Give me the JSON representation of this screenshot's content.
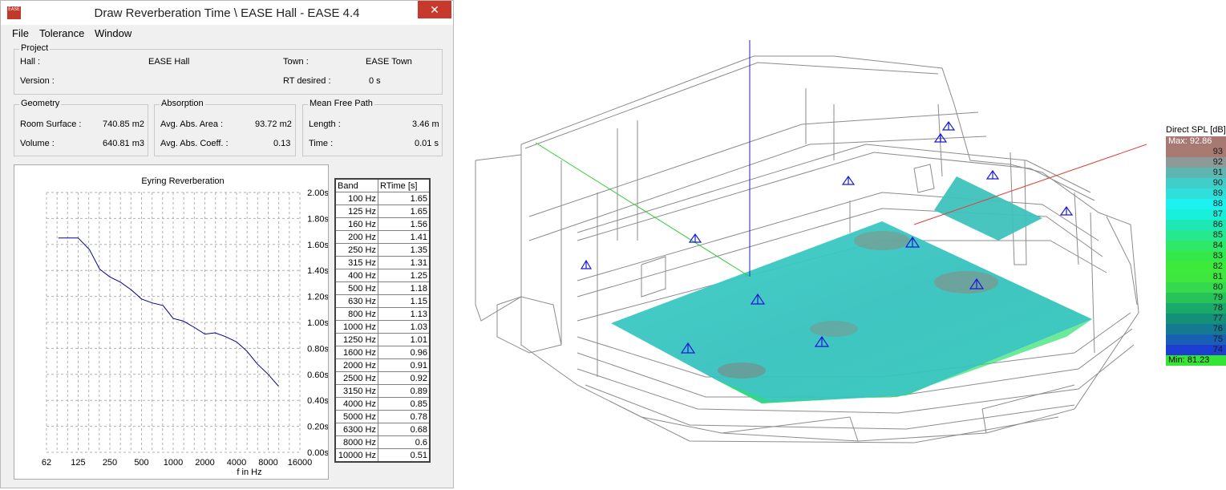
{
  "window": {
    "title": "Draw Reverberation Time \\ EASE Hall - EASE 4.4",
    "close_glyph": "✕",
    "icon_text": "EASE"
  },
  "menu": [
    "File",
    "Tolerance",
    "Window"
  ],
  "project": {
    "group_title": "Project",
    "hall_label": "Hall :",
    "hall_value": "EASE Hall",
    "town_label": "Town :",
    "town_value": "EASE Town",
    "version_label": "Version :",
    "rt_label": "RT desired :",
    "rt_value": "0 s"
  },
  "geometry": {
    "group_title": "Geometry",
    "surface_label": "Room Surface :",
    "surface_value": "740.85 m2",
    "volume_label": "Volume :",
    "volume_value": "640.81 m3"
  },
  "absorption": {
    "group_title": "Absorption",
    "area_label": "Avg. Abs. Area :",
    "area_value": "93.72 m2",
    "coeff_label": "Avg. Abs. Coeff. :",
    "coeff_value": "0.13"
  },
  "mfp": {
    "group_title": "Mean Free Path",
    "length_label": "Length :",
    "length_value": "3.46 m",
    "time_label": "Time :",
    "time_value": "0.01 s"
  },
  "chart_data": {
    "type": "line",
    "title": "Eyring Reverberation",
    "xlabel": "f in Hz",
    "ylabel": "",
    "xscale": "log",
    "xticks": [
      "62",
      "125",
      "250",
      "500",
      "1000",
      "2000",
      "4000",
      "8000",
      "16000"
    ],
    "yticks": [
      "0.00s",
      "0.20s",
      "0.40s",
      "0.60s",
      "0.80s",
      "1.00s",
      "1.20s",
      "1.40s",
      "1.60s",
      "1.80s",
      "2.00s"
    ],
    "ylim": [
      0,
      2.0
    ],
    "grid": true,
    "line_color": "#00008b",
    "x": [
      100,
      125,
      160,
      200,
      250,
      315,
      400,
      500,
      630,
      800,
      1000,
      1250,
      1600,
      2000,
      2500,
      3150,
      4000,
      5000,
      6300,
      8000,
      10000
    ],
    "values": [
      1.65,
      1.65,
      1.56,
      1.41,
      1.35,
      1.31,
      1.25,
      1.18,
      1.15,
      1.13,
      1.03,
      1.01,
      0.96,
      0.91,
      0.92,
      0.89,
      0.85,
      0.78,
      0.68,
      0.6,
      0.51
    ]
  },
  "table": {
    "headers": [
      "Band",
      "RTime [s]"
    ],
    "rows": [
      [
        "100 Hz",
        "1.65"
      ],
      [
        "125 Hz",
        "1.65"
      ],
      [
        "160 Hz",
        "1.56"
      ],
      [
        "200 Hz",
        "1.41"
      ],
      [
        "250 Hz",
        "1.35"
      ],
      [
        "315 Hz",
        "1.31"
      ],
      [
        "400 Hz",
        "1.25"
      ],
      [
        "500 Hz",
        "1.18"
      ],
      [
        "630 Hz",
        "1.15"
      ],
      [
        "800 Hz",
        "1.13"
      ],
      [
        "1000 Hz",
        "1.03"
      ],
      [
        "1250 Hz",
        "1.01"
      ],
      [
        "1600 Hz",
        "0.96"
      ],
      [
        "2000 Hz",
        "0.91"
      ],
      [
        "2500 Hz",
        "0.92"
      ],
      [
        "3150 Hz",
        "0.89"
      ],
      [
        "4000 Hz",
        "0.85"
      ],
      [
        "5000 Hz",
        "0.78"
      ],
      [
        "6300 Hz",
        "0.68"
      ],
      [
        "8000 Hz",
        "0.6"
      ],
      [
        "10000 Hz",
        "0.51"
      ]
    ]
  },
  "legend": {
    "title": "Direct SPL [dB]",
    "max_label": "Max:  92.86",
    "min_label": "Min:  81.23",
    "max_color": "#a87872",
    "min_color": "#33e633",
    "items": [
      {
        "label": "93",
        "color": "#a77a72"
      },
      {
        "label": "92",
        "color": "#8c9b97"
      },
      {
        "label": "91",
        "color": "#5fb5b2"
      },
      {
        "label": "90",
        "color": "#3fcfc8"
      },
      {
        "label": "89",
        "color": "#2fe0da"
      },
      {
        "label": "88",
        "color": "#1cf2f0"
      },
      {
        "label": "87",
        "color": "#19f0d9"
      },
      {
        "label": "86",
        "color": "#1fe6b5"
      },
      {
        "label": "85",
        "color": "#26e88f"
      },
      {
        "label": "84",
        "color": "#2ee86a"
      },
      {
        "label": "83",
        "color": "#35e84a"
      },
      {
        "label": "82",
        "color": "#3de93a"
      },
      {
        "label": "81",
        "color": "#3ee63e"
      },
      {
        "label": "80",
        "color": "#35d94d"
      },
      {
        "label": "79",
        "color": "#27c25a"
      },
      {
        "label": "78",
        "color": "#1aa96a"
      },
      {
        "label": "77",
        "color": "#148f7a"
      },
      {
        "label": "76",
        "color": "#137a92"
      },
      {
        "label": "75",
        "color": "#1a5fb6"
      },
      {
        "label": "74",
        "color": "#1d3ed2"
      }
    ]
  }
}
